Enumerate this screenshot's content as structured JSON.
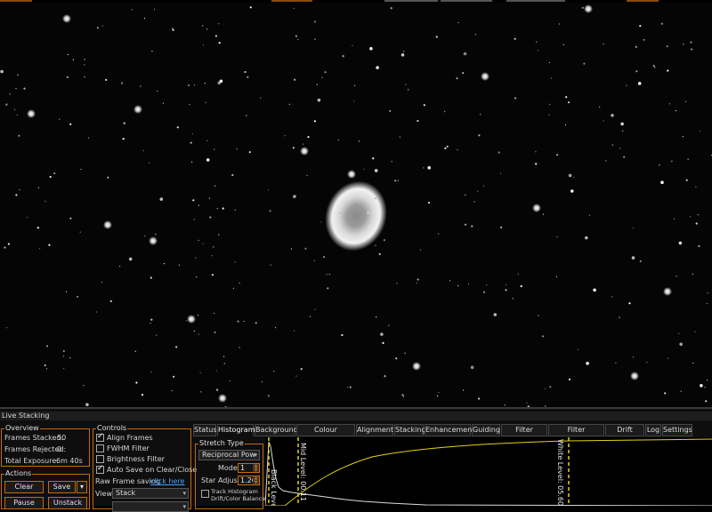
{
  "panel": {
    "title": "Live Stacking"
  },
  "overview": {
    "title": "Overview",
    "frames_stacked_label": "Frames Stacked:",
    "frames_stacked_value": "50",
    "frames_rejected_label": "Frames Rejected:",
    "frames_rejected_value": "0",
    "total_exposure_label": "Total Exposure:",
    "total_exposure_value": "6m 40s"
  },
  "actions": {
    "title": "Actions",
    "clear_label": "Clear",
    "save_label": "Save",
    "pause_label": "Pause",
    "unstack_label": "Unstack"
  },
  "controls": {
    "title": "Controls",
    "align_frames": "Align Frames",
    "fwhm_filter": "FWHM Filter",
    "brightness_filter": "Brightness Filter",
    "auto_save": "Auto Save on Clear/Close",
    "raw_frame_label": "Raw Frame saving",
    "raw_frame_link": "click here",
    "view_label": "View",
    "view_value": "Stack"
  },
  "tabs": [
    "Status",
    "Histogram",
    "Background",
    "Colour Calibration",
    "Alignment",
    "Stacking",
    "Enhancement",
    "Guiding",
    "Filter (FWHM)",
    "Filter (Brightness)",
    "Drift Graph",
    "Log",
    "Settings"
  ],
  "stretch": {
    "title": "Stretch Type",
    "type_value": "Reciprocal Pow",
    "mode_label": "Mode",
    "mode_value": "1",
    "star_adjust_label": "Star Adjust",
    "star_adjust_value": "1.20",
    "track_histogram": "Track Histogram",
    "drift_color_balance": "Drift/Color Balance"
  },
  "histogram": {
    "black_level_label": "Black Level",
    "mid_level_label": "Mid Level: 00.11",
    "white_level_label": "White Level: 05.609%"
  },
  "colors": {
    "accent": "#c56a10",
    "link": "#4aa3ff",
    "curve": "#e0d020"
  }
}
